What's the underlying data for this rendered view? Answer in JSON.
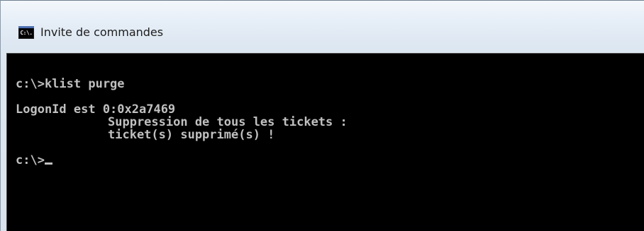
{
  "window": {
    "title": "Invite de commandes",
    "icon_text": "C:\\."
  },
  "console": {
    "line1": "c:\\>klist purge",
    "line2": "LogonId est 0:0x2a7469",
    "line3": "Suppression de tous les tickets :",
    "line4": "ticket(s) supprimé(s) !",
    "line5": "c:\\>"
  }
}
